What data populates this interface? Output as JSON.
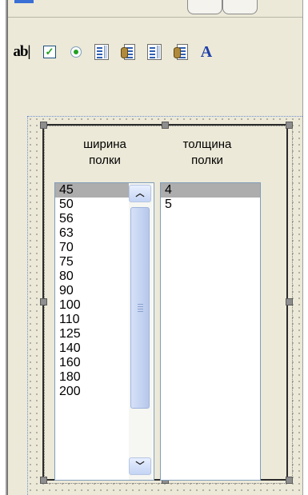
{
  "toolbar": {
    "textbox_label": "ab|",
    "label_tool_glyph": "A",
    "icons": [
      "textbox-icon",
      "checkbox-icon",
      "radio-button-icon",
      "listbox-icon",
      "combobox-icon",
      "listbox-icon",
      "combobox-icon",
      "label-icon"
    ]
  },
  "form": {
    "width_column": {
      "header": "ширина\nполки",
      "items": [
        "45",
        "50",
        "56",
        "63",
        "70",
        "75",
        "80",
        "90",
        "100",
        "110",
        "125",
        "140",
        "160",
        "180",
        "200"
      ],
      "selected": "45"
    },
    "thickness_column": {
      "header": "толщина\nполки",
      "items": [
        "4",
        "5"
      ],
      "selected": "4"
    }
  },
  "colors": {
    "selection": "#adadad",
    "surface": "#ece9d8",
    "design_border": "#6d8fd6",
    "scrollbar": "#c3d2f1"
  }
}
